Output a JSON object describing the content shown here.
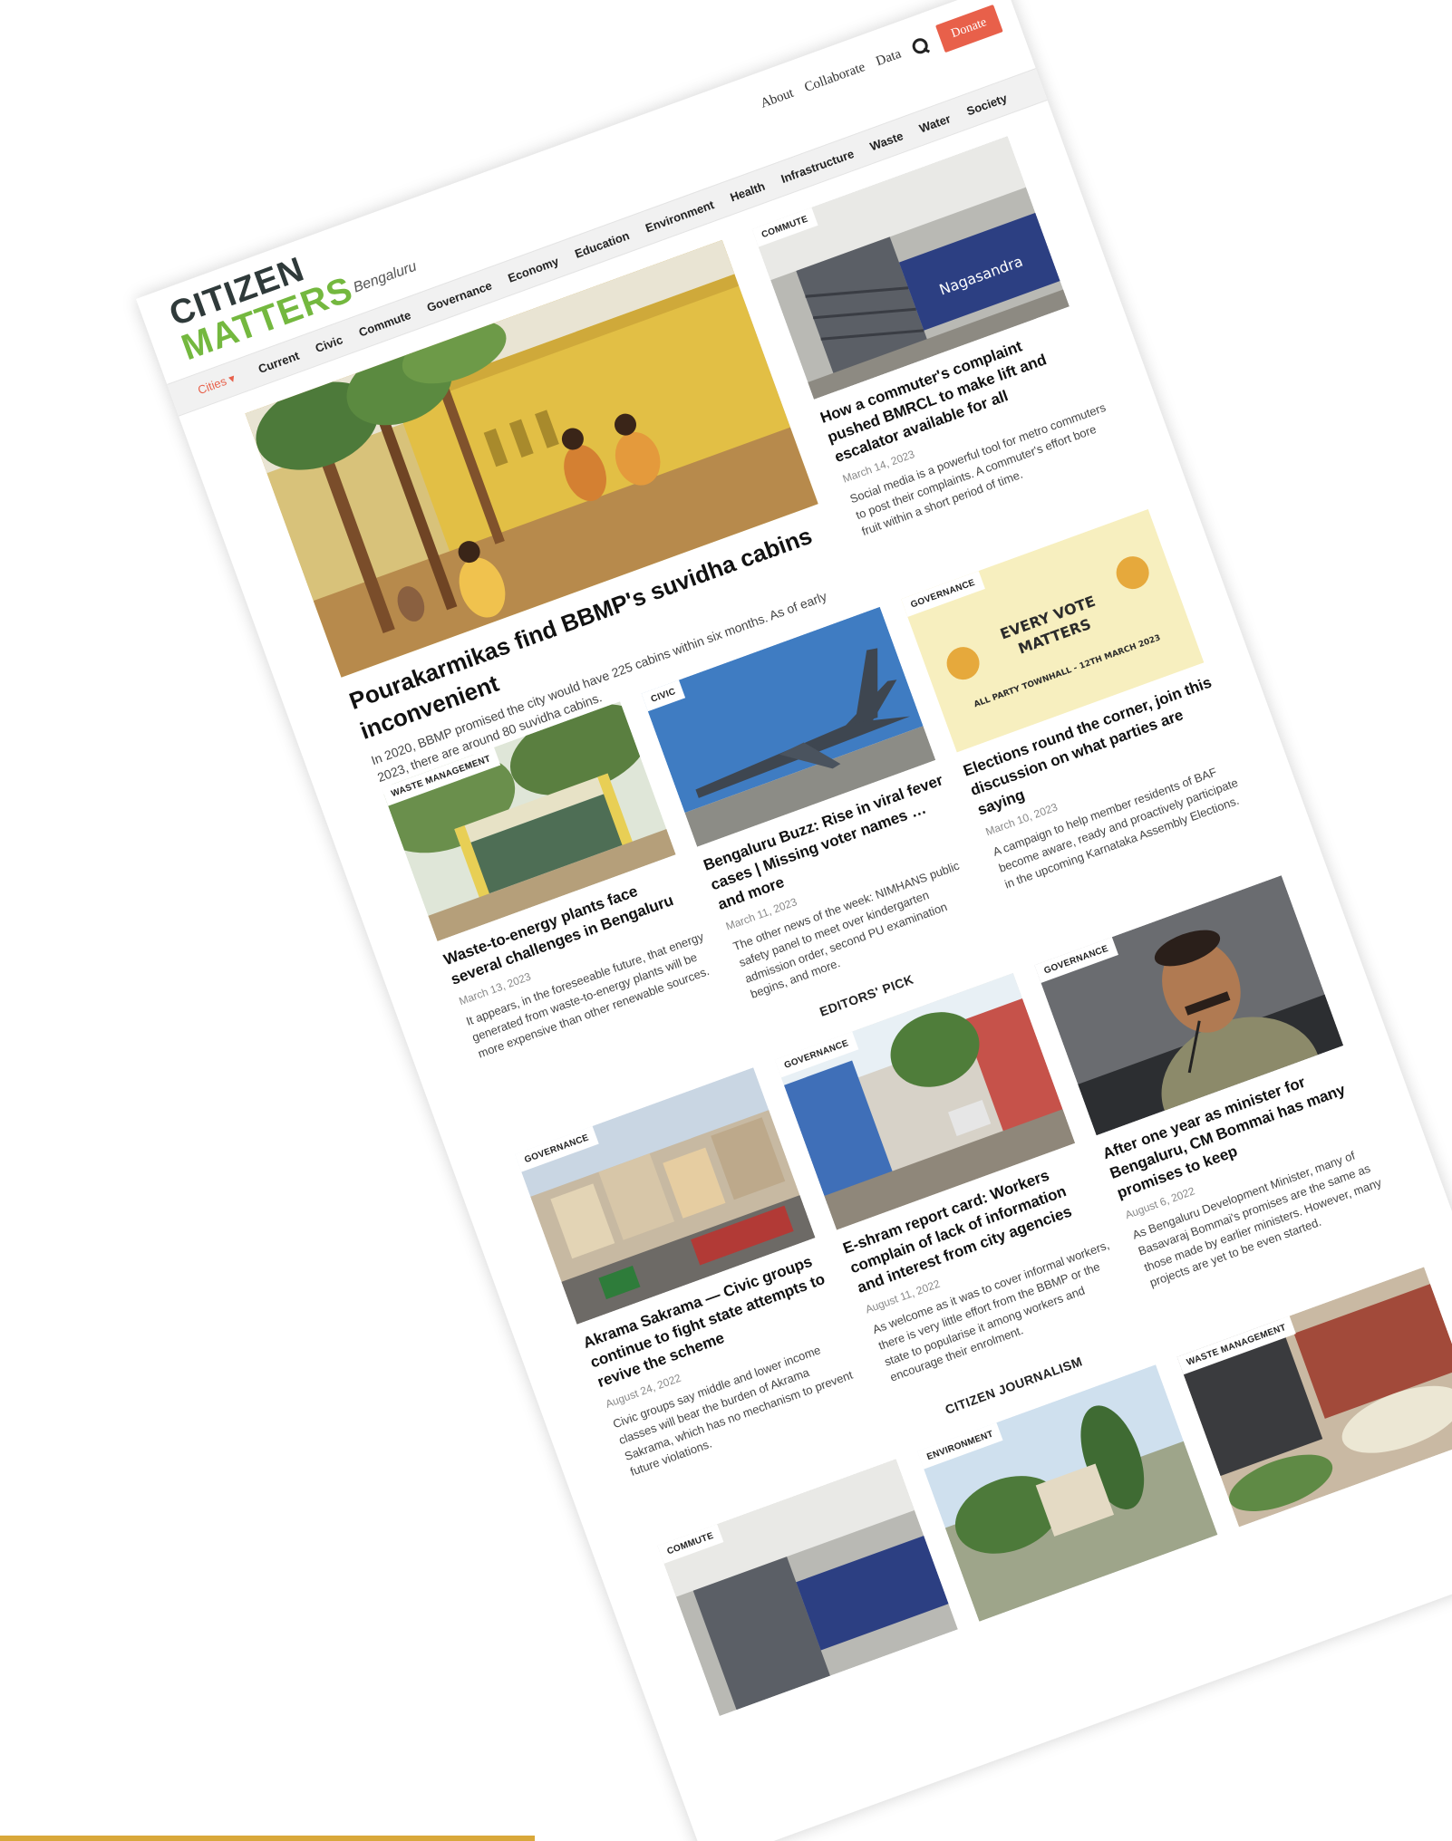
{
  "header": {
    "logo_line1": "CITIZEN",
    "logo_line2": "MATTERS",
    "location": "Bengaluru",
    "utility_links": [
      "About",
      "Collaborate",
      "Data"
    ],
    "donate_label": "Donate"
  },
  "nav": {
    "cities_label": "Cities",
    "items": [
      "Current",
      "Civic",
      "Commute",
      "Governance",
      "Economy",
      "Education",
      "Environment",
      "Health",
      "Infrastructure",
      "Waste",
      "Water",
      "Society"
    ]
  },
  "colors": {
    "brand_green": "#74b83f",
    "brand_dark": "#2f3a3a",
    "donate": "#e8604a",
    "accent_gold": "#d9a83a"
  },
  "featured": {
    "headline": "Pourakarmikas find BBMP's suvidha cabins inconvenient",
    "excerpt": "In 2020, BBMP promised the city would have 225 cabins within six months. As of early 2023, there are around 80 suvidha cabins."
  },
  "top_right": {
    "tag": "COMMUTE",
    "sign_text": "Nagasandra",
    "headline": "How a commuter's complaint pushed BMRCL to make lift and escalator available for all",
    "date": "March 14, 2023",
    "excerpt": "Social media is a powerful tool for metro commuters to post their complaints. A commuter's effort bore fruit within a short period of time."
  },
  "row2": [
    {
      "tag": "WASTE MANAGEMENT",
      "headline": "Waste-to-energy plants face several challenges in Bengaluru",
      "date": "March 13, 2023",
      "excerpt": "It appears, in the foreseeable future, that energy generated from waste-to-energy plants will be more expensive than other renewable sources."
    },
    {
      "tag": "CIVIC",
      "headline": "Bengaluru Buzz: Rise in viral fever cases | Missing voter names … and more",
      "date": "March 11, 2023",
      "excerpt": "The other news of the week: NIMHANS public safety panel to meet over kindergarten admission order, second PU examination begins, and more."
    },
    {
      "tag": "GOVERNANCE",
      "poster_line1": "EVERY VOTE",
      "poster_line2": "MATTERS",
      "poster_line3": "ALL PARTY TOWNHALL - 12TH MARCH 2023",
      "headline": "Elections round the corner, join this discussion on what parties are saying",
      "date": "March 10, 2023",
      "excerpt": "A campaign to help member residents of BAF become aware, ready and proactively participate in the upcoming Karnataka Assembly Elections."
    }
  ],
  "editors_pick": {
    "title": "EDITORS' PICK",
    "items": [
      {
        "tag": "GOVERNANCE",
        "headline": "Akrama Sakrama — Civic groups continue to fight state attempts to revive the scheme",
        "date": "August 24, 2022",
        "excerpt": "Civic groups say middle and lower income classes will bear the burden of Akrama Sakrama, which has no mechanism to prevent future violations."
      },
      {
        "tag": "GOVERNANCE",
        "headline": "E-shram report card: Workers complain of lack of information and interest from city agencies",
        "date": "August 11, 2022",
        "excerpt": "As welcome as it was to cover informal workers, there is very little effort from the BBMP or the state to popularise it among workers and encourage their enrolment."
      },
      {
        "tag": "GOVERNANCE",
        "headline": "After one year as minister for Bengaluru, CM Bommai has many promises to keep",
        "date": "August 6, 2022",
        "excerpt": "As Bengaluru Development Minister, many of Basavaraj Bommai's promises are the same as those made by earlier ministers. However, many projects are yet to be even started."
      }
    ]
  },
  "citizen_journalism": {
    "title": "CITIZEN JOURNALISM",
    "items": [
      {
        "tag": "COMMUTE"
      },
      {
        "tag": "ENVIRONMENT"
      },
      {
        "tag": "WASTE MANAGEMENT"
      }
    ]
  }
}
